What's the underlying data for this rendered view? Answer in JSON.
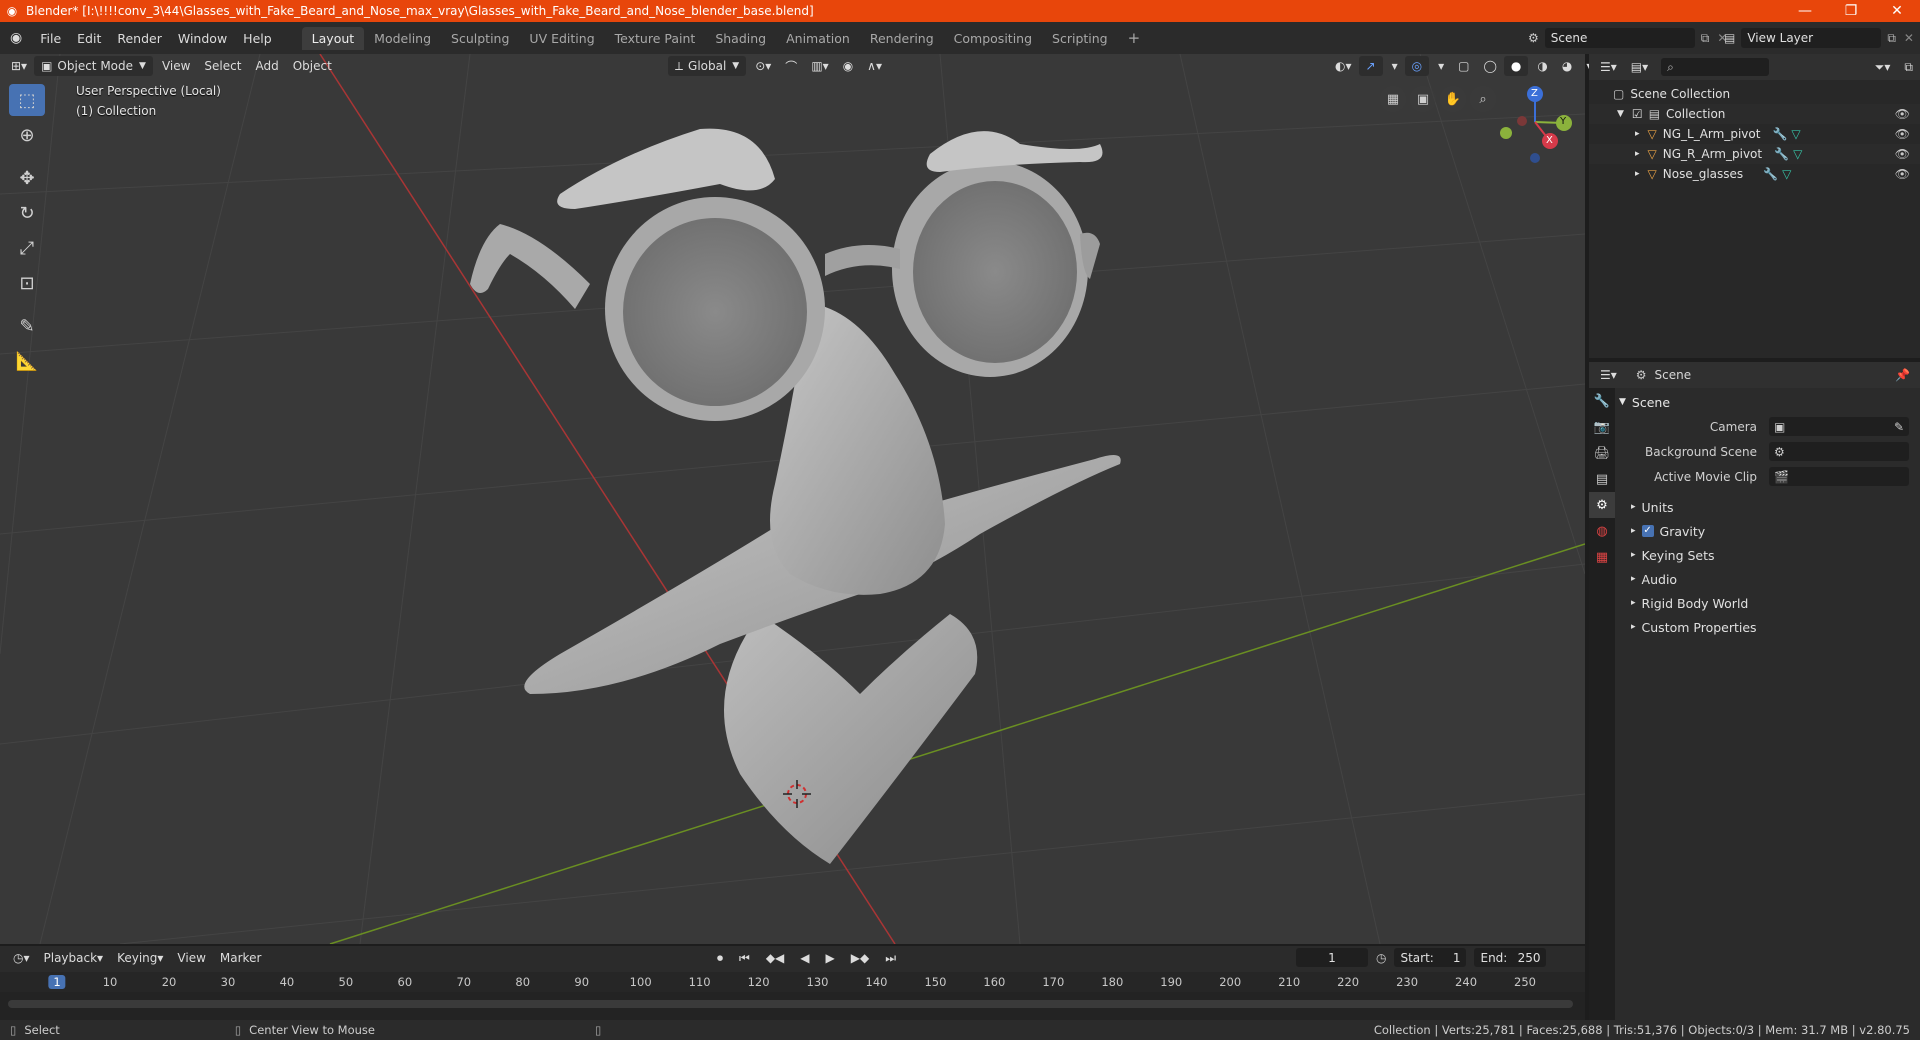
{
  "window": {
    "title": "Blender* [I:\\!!!!conv_3\\44\\Glasses_with_Fake_Beard_and_Nose_max_vray\\Glasses_with_Fake_Beard_and_Nose_blender_base.blend]",
    "minimize": "—",
    "maximize": "❐",
    "close": "✕"
  },
  "menu": [
    "File",
    "Edit",
    "Render",
    "Window",
    "Help"
  ],
  "workspaces": [
    "Layout",
    "Modeling",
    "Sculpting",
    "UV Editing",
    "Texture Paint",
    "Shading",
    "Animation",
    "Rendering",
    "Compositing",
    "Scripting"
  ],
  "active_workspace": "Layout",
  "add_workspace": "+",
  "scene_selector": "Scene",
  "view_layer_selector": "View Layer",
  "viewport": {
    "mode": "Object Mode",
    "menus": [
      "View",
      "Select",
      "Add",
      "Object"
    ],
    "transform_orientation": "Global",
    "perspective_label": "User Perspective (Local)",
    "collection_label": "(1) Collection",
    "gizmo_axes": {
      "x": "X",
      "y": "Y",
      "z": "Z"
    },
    "colors": {
      "bg": "#393939",
      "grid": "#454545",
      "x_axis": "#b13a3a",
      "y_axis": "#6c9a22",
      "model": "#b9b9b9"
    }
  },
  "outliner": {
    "scene_collection": "Scene Collection",
    "collection": "Collection",
    "items": [
      "NG_L_Arm_pivot",
      "NG_R_Arm_pivot",
      "Nose_glasses"
    ]
  },
  "properties": {
    "header": "Scene",
    "panel": "Scene",
    "fields": [
      {
        "label": "Camera",
        "value": ""
      },
      {
        "label": "Background Scene",
        "value": ""
      },
      {
        "label": "Active Movie Clip",
        "value": ""
      }
    ],
    "subpanels": [
      "Units",
      "Gravity",
      "Keying Sets",
      "Audio",
      "Rigid Body World",
      "Custom Properties"
    ],
    "gravity_checked": true
  },
  "timeline": {
    "menus": [
      "Playback",
      "Keying",
      "View",
      "Marker"
    ],
    "current_frame": "1",
    "start_label": "Start:",
    "start": "1",
    "end_label": "End:",
    "end": "250",
    "ruler": [
      "1",
      "10",
      "20",
      "30",
      "40",
      "50",
      "60",
      "70",
      "80",
      "90",
      "100",
      "110",
      "120",
      "130",
      "140",
      "150",
      "160",
      "170",
      "180",
      "190",
      "200",
      "210",
      "220",
      "230",
      "240",
      "250"
    ]
  },
  "status": {
    "select": "Select",
    "center": "Center View to Mouse",
    "info": "Collection | Verts:25,781 | Faces:25,688 | Tris:51,376 | Objects:0/3 | Mem: 31.7 MB | v2.80.75"
  }
}
